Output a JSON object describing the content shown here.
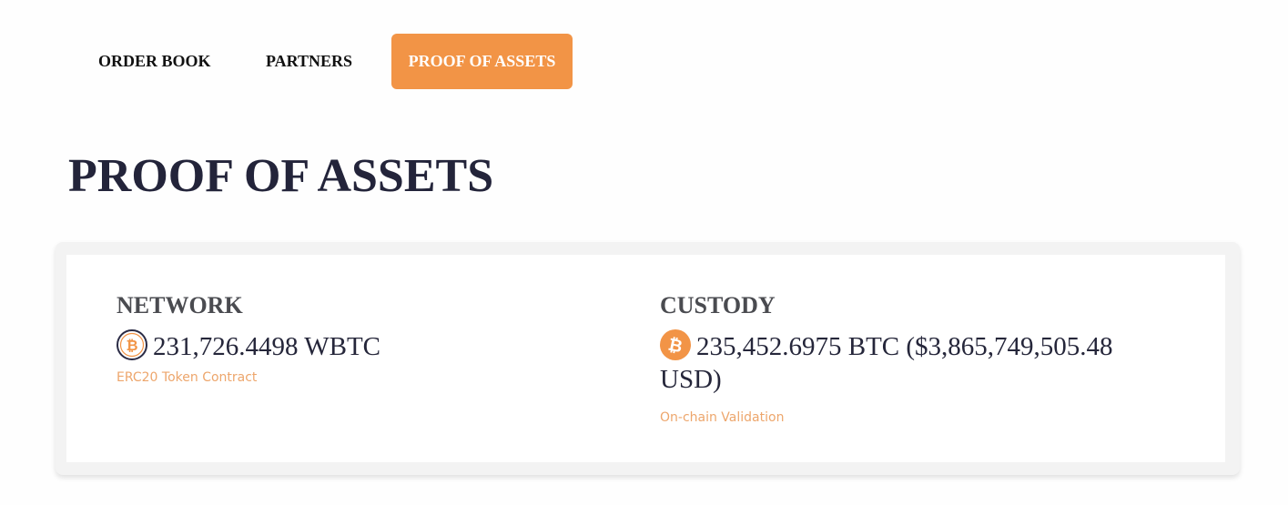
{
  "nav": {
    "items": [
      {
        "label": "ORDER BOOK"
      },
      {
        "label": "PARTNERS"
      },
      {
        "label": "PROOF OF ASSETS"
      }
    ]
  },
  "page": {
    "title": "PROOF OF ASSETS"
  },
  "network": {
    "heading": "NETWORK",
    "icon": "wbtc-icon",
    "amount": "231,726.4498 WBTC",
    "link_label": "ERC20 Token Contract"
  },
  "custody": {
    "heading": "CUSTODY",
    "icon": "bitcoin-icon",
    "amount": "235,452.6975 BTC ($3,865,749,505.48 USD)",
    "link_label": "On-chain Validation"
  },
  "colors": {
    "accent": "#f29446",
    "link": "#eda66c",
    "title": "#23243a"
  }
}
